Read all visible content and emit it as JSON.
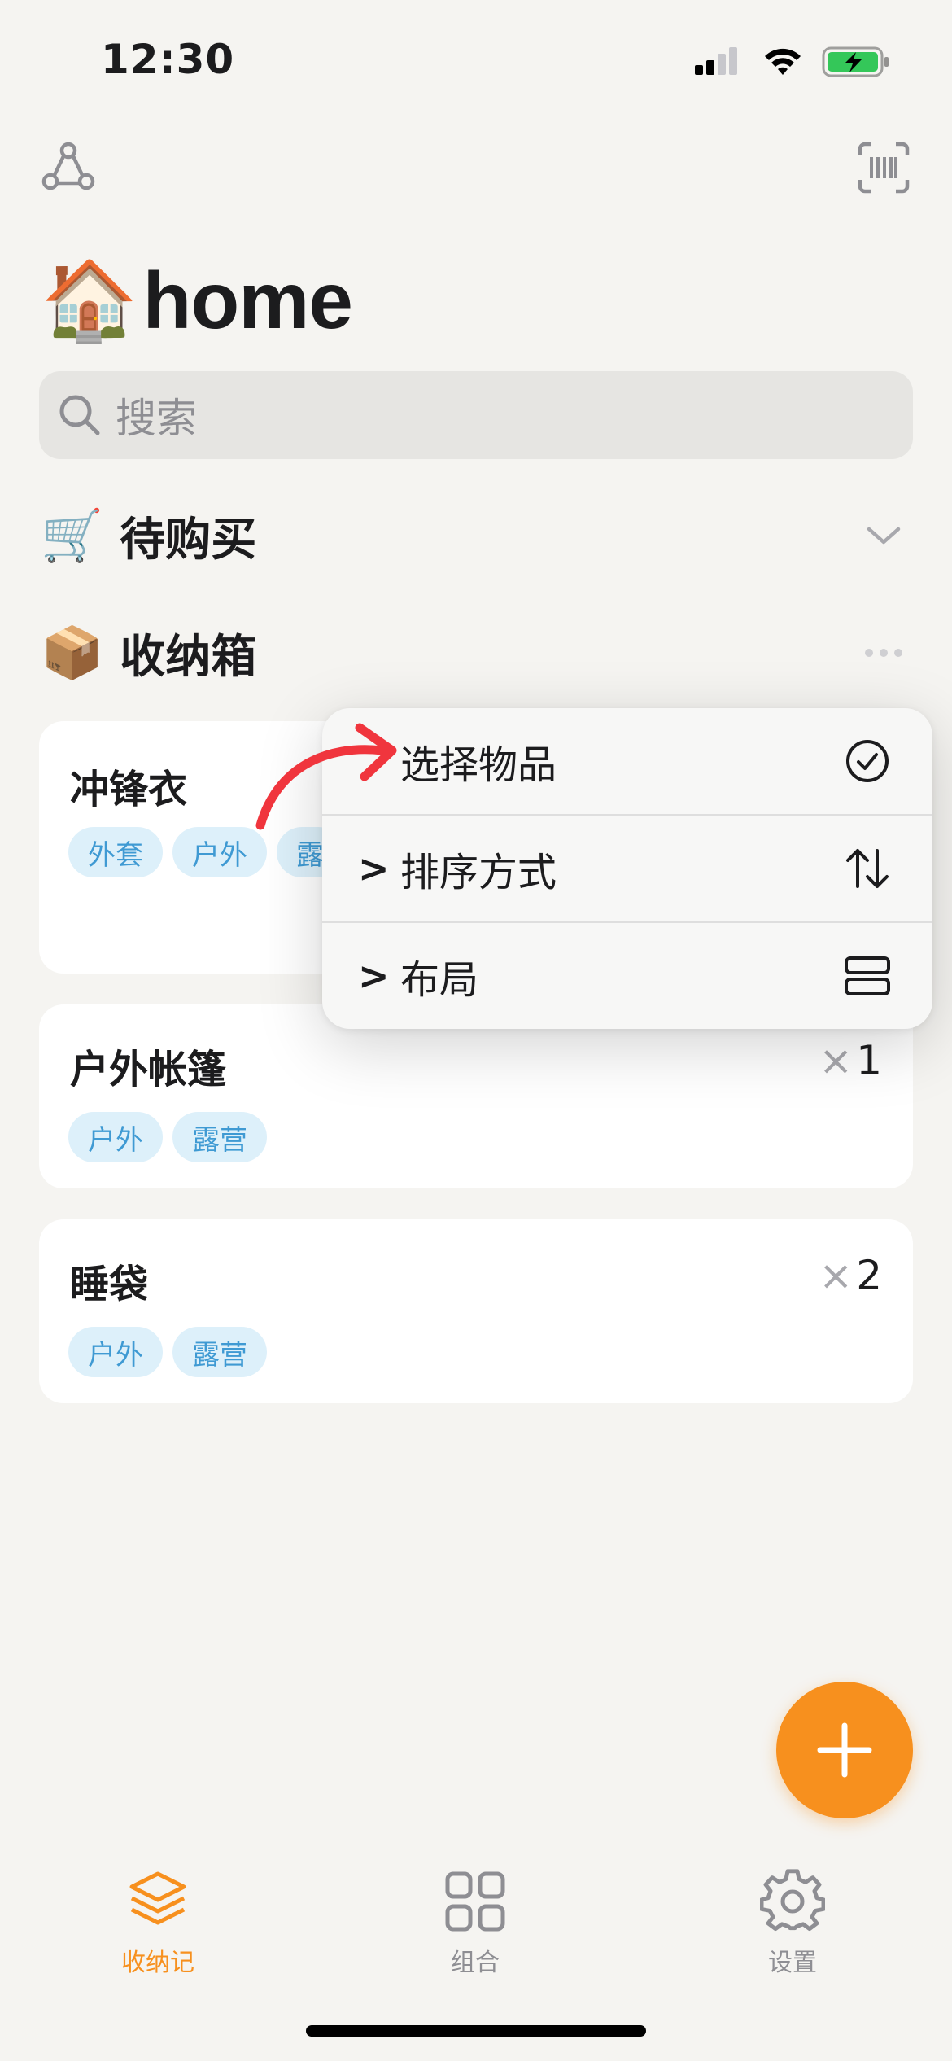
{
  "status_bar": {
    "time": "12:30"
  },
  "title": {
    "emoji": "🏠",
    "text": "home"
  },
  "search": {
    "placeholder": "搜索"
  },
  "sections": [
    {
      "emoji": "🛒",
      "label": "待购买"
    },
    {
      "emoji": "📦",
      "label": "收纳箱"
    }
  ],
  "cards": [
    {
      "name": "冲锋衣",
      "tags": [
        "外套",
        "户外",
        "露"
      ]
    },
    {
      "name": "户外帐篷",
      "tags": [
        "户外",
        "露营"
      ],
      "qty_symbol": "×",
      "qty": "1"
    },
    {
      "name": "睡袋",
      "tags": [
        "户外",
        "露营"
      ],
      "qty_symbol": "×",
      "qty": "2"
    }
  ],
  "menu": {
    "items": [
      {
        "label": "选择物品",
        "icon": "checkmark-circle-icon"
      },
      {
        "chevron": ">",
        "label": "排序方式",
        "icon": "sort-arrows-icon"
      },
      {
        "chevron": ">",
        "label": "布局",
        "icon": "layout-icon"
      }
    ]
  },
  "tabs": [
    {
      "label": "收纳记",
      "icon": "layers-icon",
      "active": true
    },
    {
      "label": "组合",
      "icon": "grid-icon",
      "active": false
    },
    {
      "label": "设置",
      "icon": "gear-icon",
      "active": false
    }
  ],
  "colors": {
    "accent": "#f7901e",
    "tag_bg": "#ddf0fa",
    "tag_text": "#3f9ad3",
    "annotation_arrow": "#f0353d",
    "battery": "#34c759"
  }
}
